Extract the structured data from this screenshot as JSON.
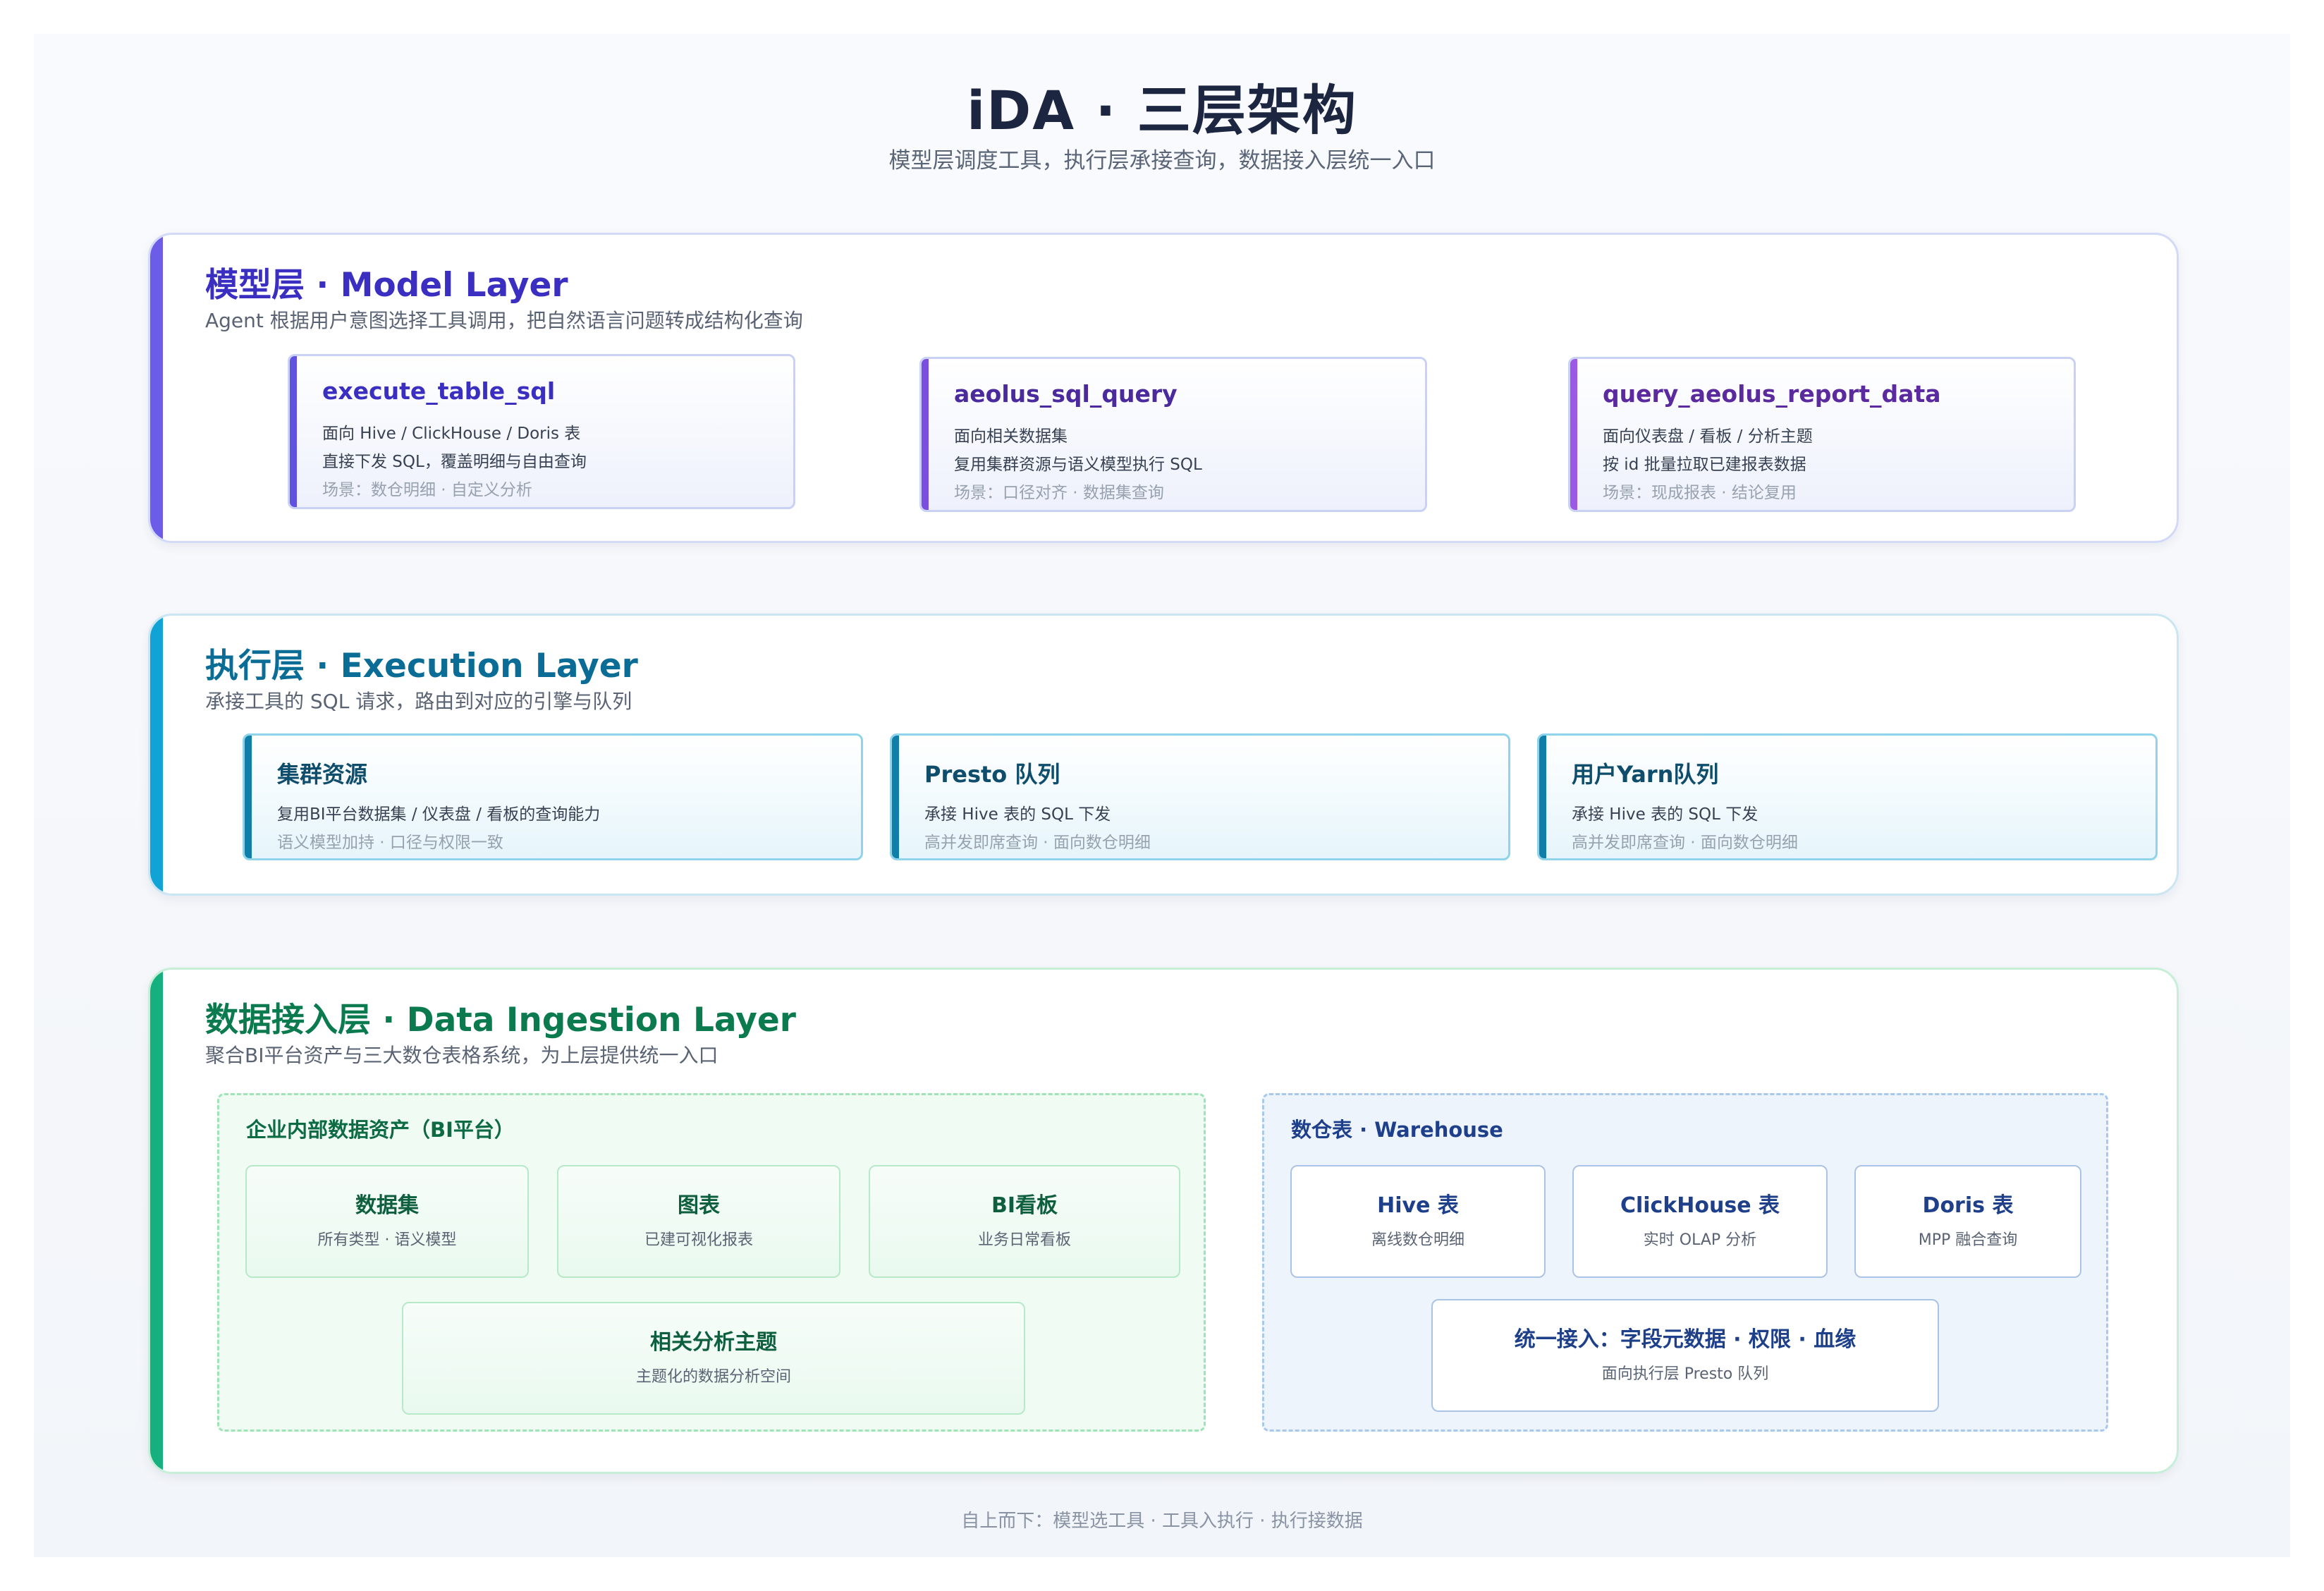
{
  "header": {
    "title": "iDA · 三层架构",
    "subtitle": "模型层调度工具，执行层承接查询，数据接入层统一入口"
  },
  "model_layer": {
    "title": "模型层 · Model Layer",
    "description": "Agent 根据用户意图选择工具调用，把自然语言问题转成结构化查询",
    "tools": [
      {
        "name": "execute_table_sql",
        "line1": "面向 Hive / ClickHouse / Doris 表",
        "line2": "直接下发 SQL，覆盖明细与自由查询",
        "line3": "场景：数仓明细 · 自定义分析",
        "color": "#3b2fc2"
      },
      {
        "name": "aeolus_sql_query",
        "line1": "面向相关数据集",
        "line2": "复用集群资源与语义模型执行 SQL",
        "line3": "场景：口径对齐 · 数据集查询",
        "color": "#4b2a9e"
      },
      {
        "name": "query_aeolus_report_data",
        "line1": "面向仪表盘 / 看板 / 分析主题",
        "line2": "按 id 批量拉取已建报表数据",
        "line3": "场景：现成报表 · 结论复用",
        "color": "#5b2a9e"
      }
    ]
  },
  "execution_layer": {
    "title": "执行层 · Execution Layer",
    "description": "承接工具的 SQL 请求，路由到对应的引擎与队列",
    "cards": [
      {
        "name": "集群资源",
        "line1": "复用BI平台数据集 / 仪表盘 / 看板的查询能力",
        "line2": "语义模型加持 · 口径与权限一致"
      },
      {
        "name": "Presto 队列",
        "line1": "承接 Hive 表的 SQL 下发",
        "line2": "高并发即席查询 · 面向数仓明细"
      },
      {
        "name": "用户Yarn队列",
        "line1": "承接 Hive 表的 SQL 下发",
        "line2": "高并发即席查询 · 面向数仓明细"
      }
    ]
  },
  "ingestion_layer": {
    "title": "数据接入层 · Data Ingestion Layer",
    "description": "聚合BI平台资产与三大数仓表格系统，为上层提供统一入口",
    "bi_group": {
      "title": "企业内部数据资产（BI平台）",
      "items": [
        {
          "name": "数据集",
          "sub": "所有类型 · 语义模型"
        },
        {
          "name": "图表",
          "sub": "已建可视化报表"
        },
        {
          "name": "BI看板",
          "sub": "业务日常看板"
        },
        {
          "name": "相关分析主题",
          "sub": "主题化的数据分析空间"
        }
      ]
    },
    "warehouse_group": {
      "title": "数仓表 · Warehouse",
      "items": [
        {
          "name": "Hive 表",
          "sub": "离线数仓明细"
        },
        {
          "name": "ClickHouse 表",
          "sub": "实时 OLAP 分析"
        },
        {
          "name": "Doris 表",
          "sub": "MPP 融合查询"
        },
        {
          "name": "统一接入：字段元数据 · 权限 · 血缘",
          "sub": "面向执行层 Presto 队列"
        }
      ]
    }
  },
  "footer": "自上而下：模型选工具 · 工具入执行 · 执行接数据"
}
